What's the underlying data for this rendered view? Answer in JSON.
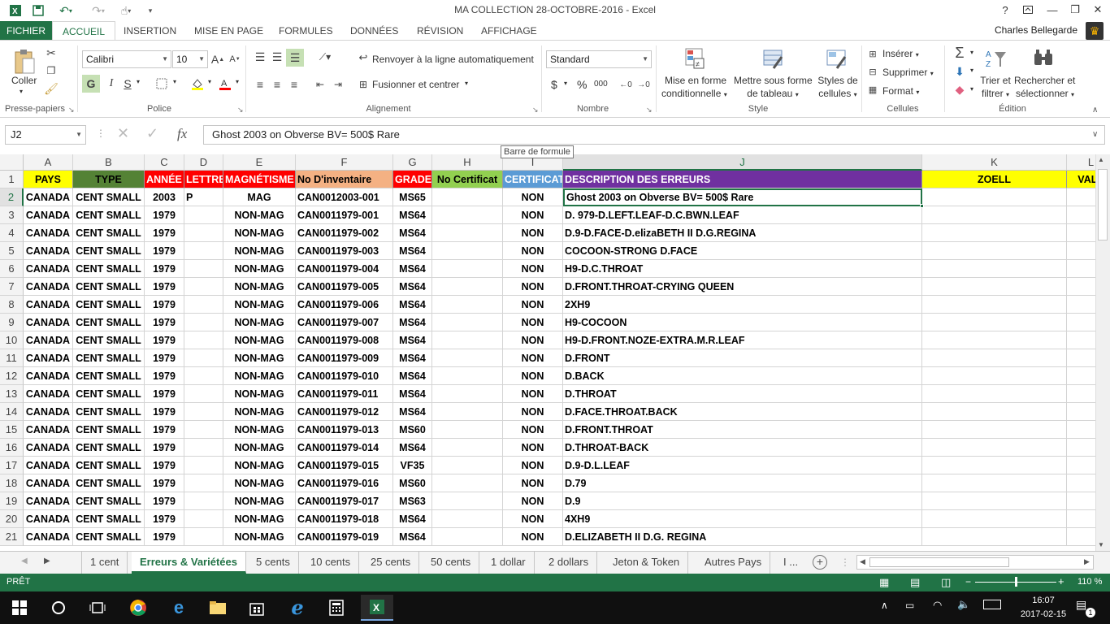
{
  "window": {
    "title": "MA COLLECTION 28-OCTOBRE-2016 - Excel"
  },
  "ribbon_tabs": [
    "FICHIER",
    "ACCUEIL",
    "INSERTION",
    "MISE EN PAGE",
    "FORMULES",
    "DONNÉES",
    "RÉVISION",
    "AFFICHAGE"
  ],
  "user": {
    "name": "Charles Bellegarde"
  },
  "ribbon": {
    "paste_label": "Coller",
    "clipboard_group": "Presse-papiers",
    "font_name": "Calibri",
    "font_size": "10",
    "bold": "G",
    "italic": "I",
    "underline": "S",
    "font_group": "Police",
    "wrap_text": "Renvoyer à la ligne automatiquement",
    "merge_center": "Fusionner et centrer",
    "alignment_group": "Alignement",
    "number_format": "Standard",
    "currency": "$",
    "percent": "%",
    "thousands": "000",
    "number_group": "Nombre",
    "conditional_format_1": "Mise en forme",
    "conditional_format_2": "conditionnelle",
    "table_format_1": "Mettre sous forme",
    "table_format_2": "de tableau",
    "cell_styles_1": "Styles de",
    "cell_styles_2": "cellules",
    "style_group": "Style",
    "insert": "Insérer",
    "delete": "Supprimer",
    "format": "Format",
    "cells_group": "Cellules",
    "sort_filter_1": "Trier et",
    "sort_filter_2": "filtrer",
    "find_select_1": "Rechercher et",
    "find_select_2": "sélectionner",
    "editing_group": "Édition"
  },
  "formula_bar": {
    "name_box": "J2",
    "fx": "fx",
    "content": "Ghost 2003 on Obverse BV= 500$ Rare",
    "tooltip": "Barre de formule"
  },
  "columns": [
    "A",
    "B",
    "C",
    "D",
    "E",
    "F",
    "G",
    "H",
    "I",
    "J",
    "K",
    "L"
  ],
  "header_row": {
    "row": "1",
    "A": "PAYS",
    "B": "TYPE",
    "C": "ANNÉE",
    "D": "LETTRE",
    "E": "MAGNÉTISME",
    "F": "No D'inventaire",
    "G": "GRADE",
    "H": "No Certificat",
    "I": "CERTIFICAT",
    "J": "DESCRIPTION DES ERREURS",
    "K": "ZOELL",
    "L": "VALE"
  },
  "header_colors": {
    "A": "#ffff00",
    "B": "#548235",
    "C": "#ff0000",
    "D": "#ff0000",
    "E": "#ff0000",
    "F": "#f4b183",
    "G": "#ff0000",
    "H": "#92d050",
    "I": "#5b9bd5",
    "J": "#7030a0",
    "K": "#ffff00",
    "L": "#ffff00"
  },
  "rows": [
    {
      "n": "2",
      "A": "CANADA",
      "B": "CENT SMALL",
      "C": "2003",
      "D": "P",
      "E": "MAG",
      "F": "CAN0012003-001",
      "G": "MS65",
      "I": "NON",
      "J": "Ghost 2003 on Obverse BV= 500$ Rare"
    },
    {
      "n": "3",
      "A": "CANADA",
      "B": "CENT SMALL",
      "C": "1979",
      "D": "",
      "E": "NON-MAG",
      "F": "CAN0011979-001",
      "G": "MS64",
      "I": "NON",
      "J": "D. 979-D.LEFT.LEAF-D.C.BWN.LEAF"
    },
    {
      "n": "4",
      "A": "CANADA",
      "B": "CENT SMALL",
      "C": "1979",
      "D": "",
      "E": "NON-MAG",
      "F": "CAN0011979-002",
      "G": "MS64",
      "I": "NON",
      "J": "D.9-D.FACE-D.elizaBETH II D.G.REGINA"
    },
    {
      "n": "5",
      "A": "CANADA",
      "B": "CENT SMALL",
      "C": "1979",
      "D": "",
      "E": "NON-MAG",
      "F": "CAN0011979-003",
      "G": "MS64",
      "I": "NON",
      "J": "COCOON-STRONG D.FACE"
    },
    {
      "n": "6",
      "A": "CANADA",
      "B": "CENT SMALL",
      "C": "1979",
      "D": "",
      "E": "NON-MAG",
      "F": "CAN0011979-004",
      "G": "MS64",
      "I": "NON",
      "J": "H9-D.C.THROAT"
    },
    {
      "n": "7",
      "A": "CANADA",
      "B": "CENT SMALL",
      "C": "1979",
      "D": "",
      "E": "NON-MAG",
      "F": "CAN0011979-005",
      "G": "MS64",
      "I": "NON",
      "J": "D.FRONT.THROAT-CRYING QUEEN"
    },
    {
      "n": "8",
      "A": "CANADA",
      "B": "CENT SMALL",
      "C": "1979",
      "D": "",
      "E": "NON-MAG",
      "F": "CAN0011979-006",
      "G": "MS64",
      "I": "NON",
      "J": "2XH9"
    },
    {
      "n": "9",
      "A": "CANADA",
      "B": "CENT SMALL",
      "C": "1979",
      "D": "",
      "E": "NON-MAG",
      "F": "CAN0011979-007",
      "G": "MS64",
      "I": "NON",
      "J": "H9-COCOON"
    },
    {
      "n": "10",
      "A": "CANADA",
      "B": "CENT SMALL",
      "C": "1979",
      "D": "",
      "E": "NON-MAG",
      "F": "CAN0011979-008",
      "G": "MS64",
      "I": "NON",
      "J": "H9-D.FRONT.NOZE-EXTRA.M.R.LEAF"
    },
    {
      "n": "11",
      "A": "CANADA",
      "B": "CENT SMALL",
      "C": "1979",
      "D": "",
      "E": "NON-MAG",
      "F": "CAN0011979-009",
      "G": "MS64",
      "I": "NON",
      "J": "D.FRONT"
    },
    {
      "n": "12",
      "A": "CANADA",
      "B": "CENT SMALL",
      "C": "1979",
      "D": "",
      "E": "NON-MAG",
      "F": "CAN0011979-010",
      "G": "MS64",
      "I": "NON",
      "J": "D.BACK"
    },
    {
      "n": "13",
      "A": "CANADA",
      "B": "CENT SMALL",
      "C": "1979",
      "D": "",
      "E": "NON-MAG",
      "F": "CAN0011979-011",
      "G": "MS64",
      "I": "NON",
      "J": "D.THROAT"
    },
    {
      "n": "14",
      "A": "CANADA",
      "B": "CENT SMALL",
      "C": "1979",
      "D": "",
      "E": "NON-MAG",
      "F": "CAN0011979-012",
      "G": "MS64",
      "I": "NON",
      "J": "D.FACE.THROAT.BACK"
    },
    {
      "n": "15",
      "A": "CANADA",
      "B": "CENT SMALL",
      "C": "1979",
      "D": "",
      "E": "NON-MAG",
      "F": "CAN0011979-013",
      "G": "MS60",
      "I": "NON",
      "J": "D.FRONT.THROAT"
    },
    {
      "n": "16",
      "A": "CANADA",
      "B": "CENT SMALL",
      "C": "1979",
      "D": "",
      "E": "NON-MAG",
      "F": "CAN0011979-014",
      "G": "MS64",
      "I": "NON",
      "J": "D.THROAT-BACK"
    },
    {
      "n": "17",
      "A": "CANADA",
      "B": "CENT SMALL",
      "C": "1979",
      "D": "",
      "E": "NON-MAG",
      "F": "CAN0011979-015",
      "G": "VF35",
      "I": "NON",
      "J": "D.9-D.L.LEAF"
    },
    {
      "n": "18",
      "A": "CANADA",
      "B": "CENT SMALL",
      "C": "1979",
      "D": "",
      "E": "NON-MAG",
      "F": "CAN0011979-016",
      "G": "MS60",
      "I": "NON",
      "J": "D.79"
    },
    {
      "n": "19",
      "A": "CANADA",
      "B": "CENT SMALL",
      "C": "1979",
      "D": "",
      "E": "NON-MAG",
      "F": "CAN0011979-017",
      "G": "MS63",
      "I": "NON",
      "J": "D.9"
    },
    {
      "n": "20",
      "A": "CANADA",
      "B": "CENT SMALL",
      "C": "1979",
      "D": "",
      "E": "NON-MAG",
      "F": "CAN0011979-018",
      "G": "MS64",
      "I": "NON",
      "J": "4XH9"
    },
    {
      "n": "21",
      "A": "CANADA",
      "B": "CENT SMALL",
      "C": "1979",
      "D": "",
      "E": "NON-MAG",
      "F": "CAN0011979-019",
      "G": "MS64",
      "I": "NON",
      "J": "D.ELIZABETH II D.G. REGINA"
    }
  ],
  "sheet_tabs": [
    "1 cent",
    "Erreurs & Variétées",
    "5 cents",
    "10 cents",
    "25 cents",
    "50 cents",
    "1 dollar",
    "2 dollars",
    "Jeton & Token",
    "Autres Pays",
    "I ..."
  ],
  "status": {
    "ready": "PRÊT",
    "zoom": "110 %"
  },
  "taskbar": {
    "time": "16:07",
    "date": "2017-02-15",
    "notifications": "1"
  }
}
